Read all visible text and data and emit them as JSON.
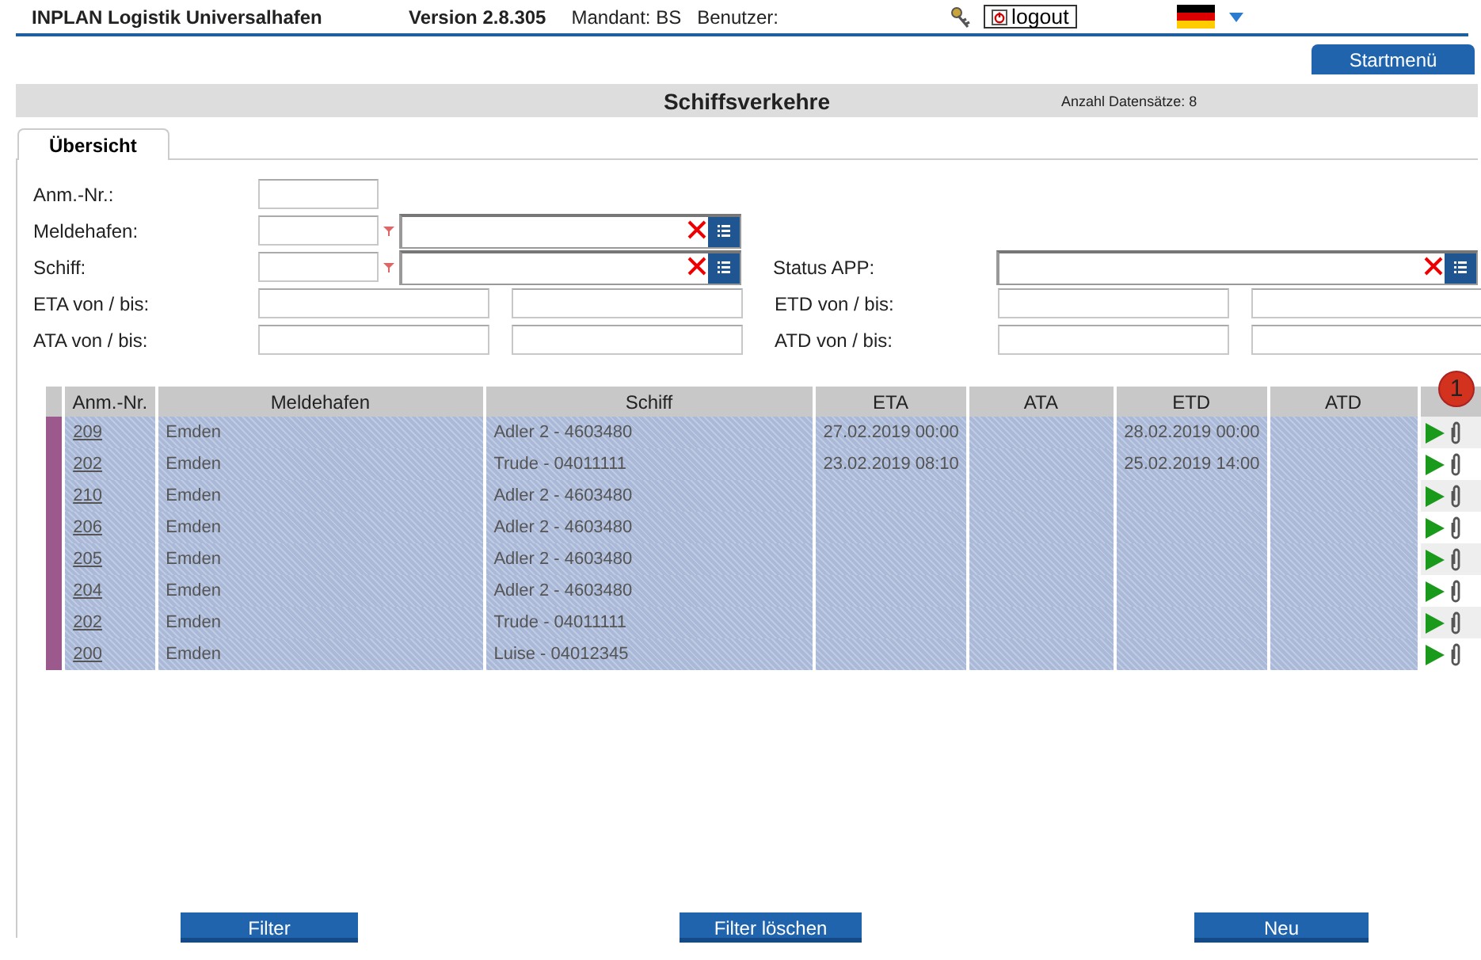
{
  "header": {
    "app_name": "INPLAN Logistik Universalhafen",
    "version": "Version 2.8.305",
    "mandant": "Mandant: BS",
    "user_label": "Benutzer:",
    "logout": "logout"
  },
  "startmenu": "Startmenü",
  "page_title": "Schiffsverkehre",
  "record_count": "Anzahl Datensätze: 8",
  "tabs": [
    {
      "label": "Übersicht",
      "selected": true
    }
  ],
  "filter_rows": [
    {
      "left": {
        "label": "Anm.-Nr.:",
        "kind": "short"
      }
    },
    {
      "left": {
        "label": "Meldehafen:",
        "kind": "lookup"
      }
    },
    {
      "left": {
        "label": "Schiff:",
        "kind": "lookup"
      },
      "right": {
        "label": "Status APP:",
        "kind": "select"
      }
    },
    {
      "left": {
        "label": "ETA von / bis:",
        "kind": "range"
      },
      "right": {
        "label": "ETD von / bis:",
        "kind": "range"
      }
    },
    {
      "left": {
        "label": "ATA von / bis:",
        "kind": "range"
      },
      "right": {
        "label": "ATD von / bis:",
        "kind": "range"
      }
    }
  ],
  "table": {
    "columns": [
      "Anm.-Nr.",
      "Meldehafen",
      "Schiff",
      "ETA",
      "ATA",
      "ETD",
      "ATD"
    ],
    "badge": "1",
    "rows": [
      {
        "selected": true,
        "cells": [
          "209",
          "Emden",
          "Adler 2 - 4603480",
          "27.02.2019 00:00",
          "",
          "28.02.2019 00:00",
          ""
        ]
      },
      {
        "selected": true,
        "cells": [
          "202",
          "Emden",
          "Trude - 04011111",
          "23.02.2019 08:10",
          "",
          "25.02.2019 14:00",
          ""
        ]
      },
      {
        "selected": true,
        "cells": [
          "210",
          "Emden",
          "Adler 2 - 4603480",
          "",
          "",
          "",
          ""
        ]
      },
      {
        "selected": true,
        "cells": [
          "206",
          "Emden",
          "Adler 2 - 4603480",
          "",
          "",
          "",
          ""
        ]
      },
      {
        "selected": true,
        "cells": [
          "205",
          "Emden",
          "Adler 2 - 4603480",
          "",
          "",
          "",
          ""
        ]
      },
      {
        "selected": true,
        "cells": [
          "204",
          "Emden",
          "Adler 2 - 4603480",
          "",
          "",
          "",
          ""
        ]
      },
      {
        "selected": true,
        "cells": [
          "202",
          "Emden",
          "Trude - 04011111",
          "",
          "",
          "",
          ""
        ]
      },
      {
        "selected": true,
        "cells": [
          "200",
          "Emden",
          "Luise - 04012345",
          "",
          "",
          "",
          ""
        ]
      }
    ]
  },
  "buttons": [
    "Filter",
    "Filter löschen",
    "Neu"
  ]
}
